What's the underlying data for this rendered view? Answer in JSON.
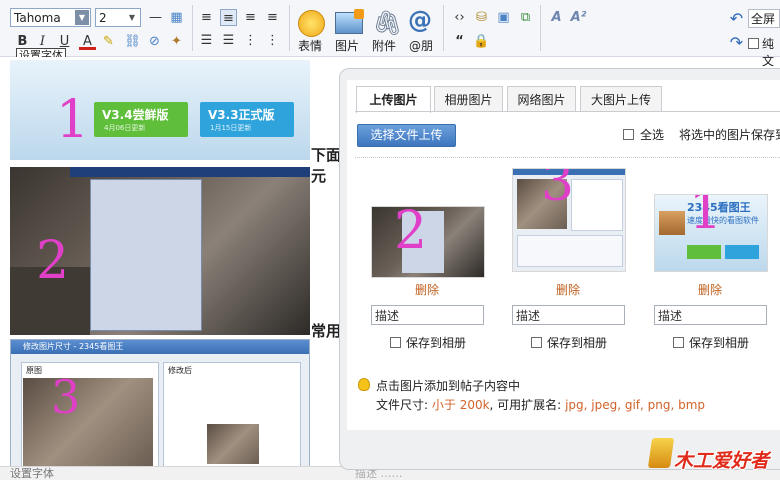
{
  "toolbar": {
    "font_name": "Tahoma",
    "font_size": "2",
    "tooltip": "设置字体",
    "big_buttons": [
      "表情",
      "图片",
      "附件",
      "@朋"
    ],
    "fullscreen": "全屏",
    "plaintext": "纯文"
  },
  "editor": {
    "text_1": "下面元",
    "text_2": "常用",
    "shot1": {
      "number": "1",
      "button_a": "V3.4尝鲜版",
      "button_a_sub": "4月06日更新",
      "button_b": "V3.3正式版",
      "button_b_sub": "1月15日更新"
    },
    "shot2": {
      "number": "2"
    },
    "shot3": {
      "number": "3",
      "window_title": "修改图片尺寸 - 2345看图王",
      "panel_left": "原图",
      "panel_right": "修改后"
    }
  },
  "status": {
    "left": "设置字体",
    "right": "描述 ……"
  },
  "dialog": {
    "tabs": [
      "上传图片",
      "相册图片",
      "网络图片",
      "大图片上传"
    ],
    "choose_button": "选择文件上传",
    "select_all": "全选",
    "save_selected": "将选中的图片保存到",
    "thumbs": [
      {
        "number": "2",
        "delete": "删除",
        "desc": "描述",
        "save": "保存到相册"
      },
      {
        "number": "3",
        "delete": "删除",
        "desc": "描述",
        "save": "保存到相册"
      },
      {
        "number": "1",
        "delete": "删除",
        "desc": "描述",
        "save": "保存到相册",
        "brand": "2345看图王",
        "slogan": "速度最快的看图软件"
      }
    ],
    "hint_line1": "点击图片添加到帖子内容中",
    "hint_prefix": "文件尺寸:",
    "hint_size": "小于 200k",
    "hint_mid": ", 可用扩展名:",
    "hint_exts": "jpg, jpeg, gif, png, bmp"
  },
  "logo": {
    "text": "木工爱好者"
  }
}
